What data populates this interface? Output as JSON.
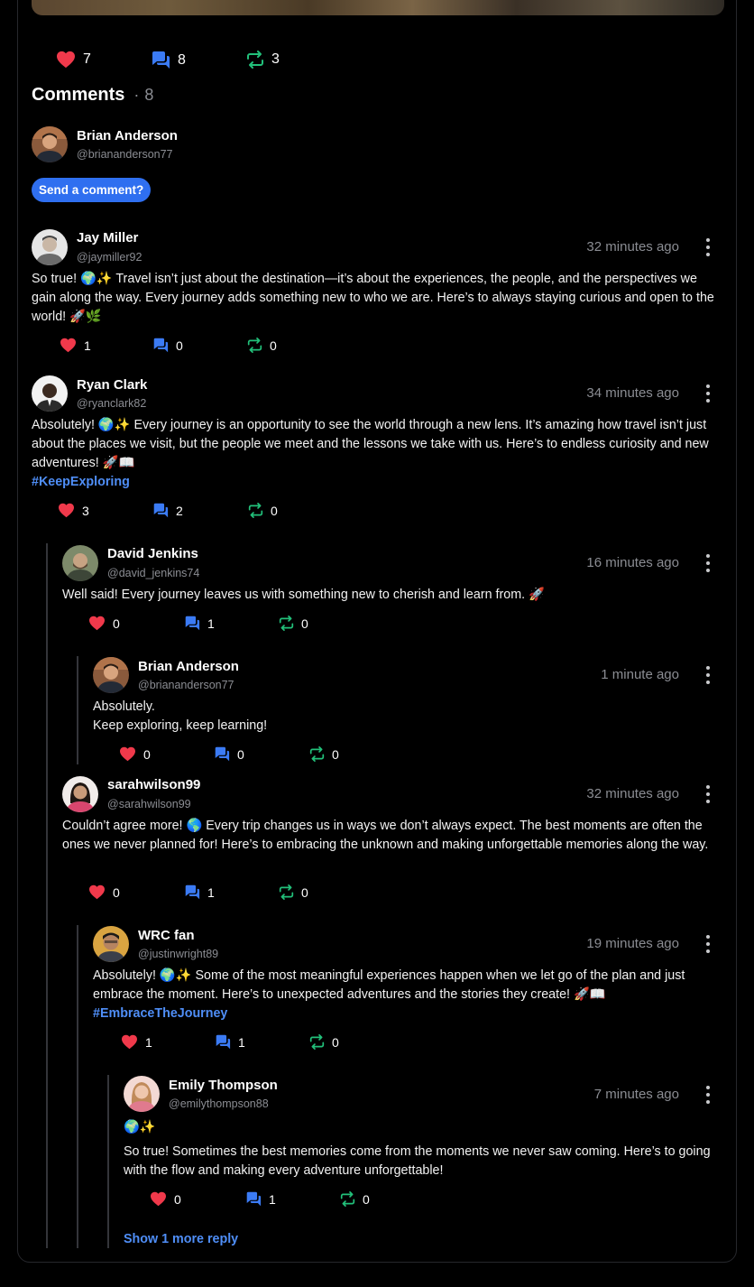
{
  "post_stats": {
    "likes": "7",
    "comments": "8",
    "reposts": "3"
  },
  "comments_header": {
    "title": "Comments",
    "separator": "·",
    "count": "8"
  },
  "current_user": {
    "name": "Brian Anderson",
    "handle": "@briananderson77"
  },
  "send_comment_label": "Send a comment?",
  "comments": [
    {
      "name": "Jay Miller",
      "handle": "@jaymiller92",
      "time": "32 minutes ago",
      "text": "So true! 🌍✨ Travel isn’t just about the destination—it’s about the experiences, the people, and the perspectives we gain along the way. Every journey adds something new to who we are. Here’s to always staying curious and open to the world! 🚀🌿",
      "likes": "1",
      "replies": "0",
      "reposts": "0"
    },
    {
      "name": "Ryan Clark",
      "handle": "@ryanclark82",
      "time": "34 minutes ago",
      "text": "Absolutely! 🌍✨ Every journey is an opportunity to see the world through a new lens. It’s amazing how travel isn’t just about the places we visit, but the people we meet and the lessons we take with us. Here’s to endless curiosity and new adventures! 🚀📖",
      "hashtag": "#KeepExploring",
      "likes": "3",
      "replies": "2",
      "reposts": "0"
    },
    {
      "name": "David Jenkins",
      "handle": "@david_jenkins74",
      "time": "16 minutes ago",
      "text": "Well said! Every journey leaves us with something new to cherish and learn from. 🚀",
      "likes": "0",
      "replies": "1",
      "reposts": "0"
    },
    {
      "name": "Brian Anderson",
      "handle": "@briananderson77",
      "time": "1 minute ago",
      "text_line1": "Absolutely.",
      "text_line2": "Keep exploring, keep learning!",
      "likes": "0",
      "replies": "0",
      "reposts": "0"
    },
    {
      "name": "sarahwilson99",
      "handle": "@sarahwilson99",
      "time": "32 minutes ago",
      "text": "Couldn’t agree more! 🌎 Every trip changes us in ways we don’t always expect. The best moments are often the ones we never planned for! Here’s to embracing the unknown and making unforgettable memories along the way.",
      "likes": "0",
      "replies": "1",
      "reposts": "0"
    },
    {
      "name": "WRC fan",
      "handle": "@justinwright89",
      "time": "19 minutes ago",
      "text": "Absolutely! 🌍✨ Some of the most meaningful experiences happen when we let go of the plan and just embrace the moment. Here’s to unexpected adventures and the stories they create! 🚀📖",
      "hashtag": "#EmbraceTheJourney",
      "likes": "1",
      "replies": "1",
      "reposts": "0"
    },
    {
      "name": "Emily Thompson",
      "handle": "@emilythompson88",
      "time": "7 minutes ago",
      "text_line1": "🌍✨",
      "text": "So true! Sometimes the best memories come from the moments we never saw coming. Here’s to going with the flow and making every adventure unforgettable!",
      "likes": "0",
      "replies": "1",
      "reposts": "0"
    }
  ],
  "show_more_label": "Show 1 more reply",
  "colors": {
    "like": "#f0394b",
    "comment": "#3b7bf5",
    "repost": "#22c07a",
    "link": "#4f8ef7",
    "button": "#2f6ff0"
  },
  "icons": {
    "like": "heart-icon",
    "comment": "comment-icon",
    "repost": "repost-icon",
    "menu": "more-vertical-icon"
  }
}
